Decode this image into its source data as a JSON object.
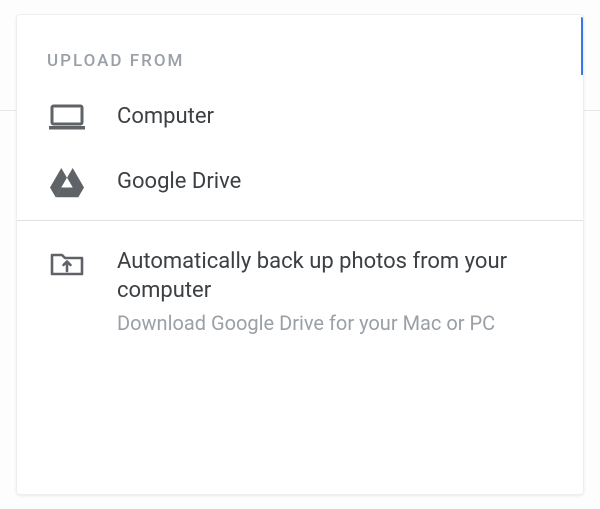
{
  "header": {
    "title": "UPLOAD FROM"
  },
  "options": {
    "computer": {
      "label": "Computer"
    },
    "drive": {
      "label": "Google Drive"
    }
  },
  "backup": {
    "title": "Automatically back up photos from your computer",
    "subtitle": "Download Google Drive for your Mac or PC"
  },
  "colors": {
    "icon": "#5f6368",
    "text": "#3c4043",
    "muted": "#9aa0a6"
  }
}
